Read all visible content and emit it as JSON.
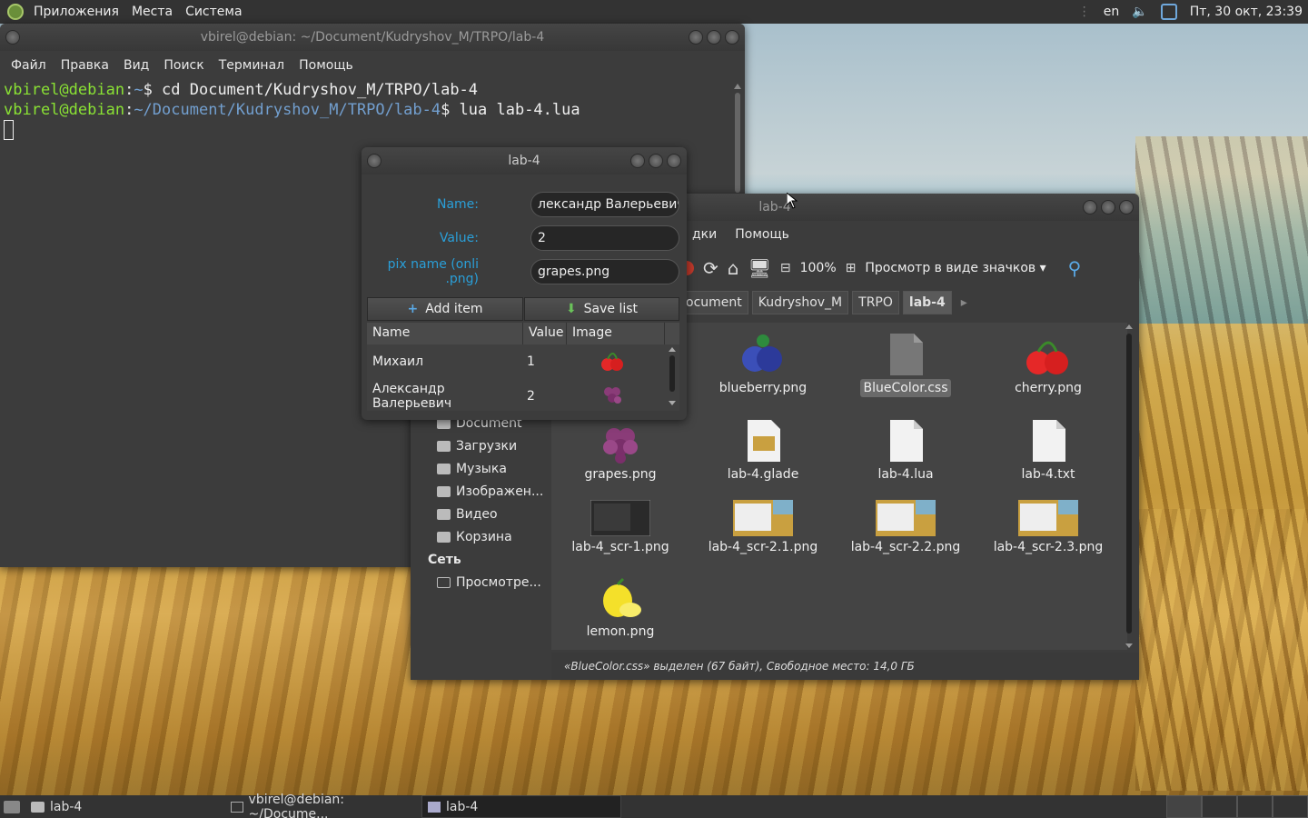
{
  "top_panel": {
    "menus": [
      "Приложения",
      "Места",
      "Система"
    ],
    "keyboard_layout": "en",
    "datetime": "Пт, 30 окт, 23:39"
  },
  "terminal": {
    "title": "vbirel@debian: ~/Document/Kudryshov_M/TRPO/lab-4",
    "menu": [
      "Файл",
      "Правка",
      "Вид",
      "Поиск",
      "Терминал",
      "Помощь"
    ],
    "line1_user": "vbirel@debian",
    "line1_sep": ":",
    "line1_path": "~",
    "line1_cmd": "$ cd Document/Kudryshov_M/TRPO/lab-4",
    "line2_user": "vbirel@debian",
    "line2_sep": ":",
    "line2_path": "~/Document/Kudryshov_M/TRPO/lab-4",
    "line2_cmd": "$ lua lab-4.lua"
  },
  "file_manager": {
    "title": "lab-4",
    "menu": [
      "дки",
      "Помощь"
    ],
    "zoom": "100%",
    "view_mode": "Просмотр в виде значков",
    "path": [
      "ocument",
      "Kudryshov_M",
      "TRPO",
      "lab-4"
    ],
    "sidebar": {
      "places": [
        "Document",
        "Загрузки",
        "Музыка",
        "Изображен...",
        "Видео",
        "Корзина"
      ],
      "network_header": "Сеть",
      "network": [
        "Просмотре..."
      ]
    },
    "files": [
      "blueberry.png",
      "BlueColor.css",
      "cherry.png",
      "grapes.png",
      "lab-4.glade",
      "lab-4.lua",
      "lab-4.txt",
      "lab-4_scr-1.png",
      "lab-4_scr-2.1.png",
      "lab-4_scr-2.2.png",
      "lab-4_scr-2.3.png",
      "lemon.png"
    ],
    "status": "«BlueColor.css» выделен (67 байт), Свободное место: 14,0 ГБ"
  },
  "dialog": {
    "title": "lab-4",
    "name_label": "Name:",
    "name_value": "лександр Валерьевич",
    "value_label": "Value:",
    "value_value": "2",
    "pix_label": "pix name (onli .png)",
    "pix_value": "grapes.png",
    "add_button": "Add item",
    "save_button": "Save list",
    "columns": [
      "Name",
      "Value",
      "Image"
    ],
    "rows": [
      {
        "name": "Михаил",
        "value": "1",
        "image": "cherry"
      },
      {
        "name": "Александр Валерьевич",
        "value": "2",
        "image": "grapes"
      }
    ]
  },
  "bottom_panel": {
    "tasks": [
      "lab-4",
      "vbirel@debian: ~/Docume...",
      "lab-4"
    ]
  },
  "colors": {
    "label_blue": "#2a9fd8",
    "prompt_green": "#8ae234",
    "path_blue": "#729fcf"
  }
}
